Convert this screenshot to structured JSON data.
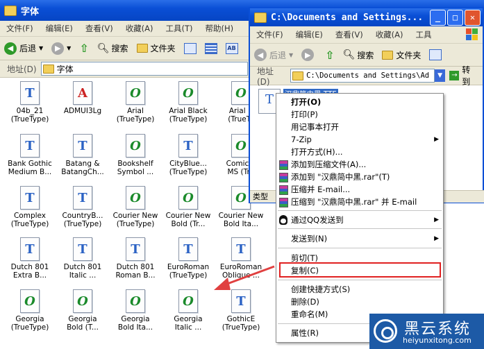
{
  "back_window": {
    "title": "字体",
    "menu": [
      "文件(F)",
      "编辑(E)",
      "查看(V)",
      "收藏(A)",
      "工具(T)",
      "帮助(H)"
    ],
    "toolbar": {
      "back": "后退",
      "search": "搜索",
      "folders": "文件夹"
    },
    "address_label": "地址(D)",
    "address_value": "字体"
  },
  "fonts": [
    {
      "n1": "04b_21",
      "n2": "(TrueType)",
      "kind": "tt"
    },
    {
      "n1": "ADMUI3Lg",
      "n2": "",
      "kind": "ad"
    },
    {
      "n1": "Arial",
      "n2": "(TrueType)",
      "kind": "op"
    },
    {
      "n1": "Arial Black",
      "n2": "(TrueType)",
      "kind": "op"
    },
    {
      "n1": "Arial B",
      "n2": "(TrueTy",
      "kind": "op"
    },
    {
      "n1": "Bank Gothic",
      "n2": "Medium B...",
      "kind": "tt"
    },
    {
      "n1": "Batang &",
      "n2": "BatangCh...",
      "kind": "tt"
    },
    {
      "n1": "Bookshelf",
      "n2": "Symbol ...",
      "kind": "op"
    },
    {
      "n1": "CityBlue...",
      "n2": "(TrueType)",
      "kind": "tt"
    },
    {
      "n1": "Comic S",
      "n2": "MS (Tru",
      "kind": "op"
    },
    {
      "n1": "Complex",
      "n2": "(TrueType)",
      "kind": "tt"
    },
    {
      "n1": "CountryB...",
      "n2": "(TrueType)",
      "kind": "tt"
    },
    {
      "n1": "Courier New",
      "n2": "(TrueType)",
      "kind": "op"
    },
    {
      "n1": "Courier New",
      "n2": "Bold (Tr...",
      "kind": "op"
    },
    {
      "n1": "Courier New",
      "n2": "Bold Ita...",
      "kind": "op"
    },
    {
      "n1": "Dutch 801",
      "n2": "Extra B...",
      "kind": "tt"
    },
    {
      "n1": "Dutch 801",
      "n2": "Italic ...",
      "kind": "tt"
    },
    {
      "n1": "Dutch 801",
      "n2": "Roman B...",
      "kind": "tt"
    },
    {
      "n1": "EuroRoman",
      "n2": "(TrueType)",
      "kind": "tt"
    },
    {
      "n1": "EuroRoman",
      "n2": "Oblique ...",
      "kind": "tt"
    },
    {
      "n1": "Georgia",
      "n2": "(TrueType)",
      "kind": "op"
    },
    {
      "n1": "Georgia",
      "n2": "Bold (T...",
      "kind": "op"
    },
    {
      "n1": "Georgia",
      "n2": "Bold Ita...",
      "kind": "op"
    },
    {
      "n1": "Georgia",
      "n2": "Italic ...",
      "kind": "op"
    },
    {
      "n1": "GothicE",
      "n2": "(TrueType)",
      "kind": "tt"
    }
  ],
  "front_window": {
    "title": "C:\\Documents and Settings...",
    "menu": [
      "文件(F)",
      "编辑(E)",
      "查看(V)",
      "收藏(A)",
      "工具"
    ],
    "toolbar": {
      "back": "后退",
      "search": "搜索",
      "folders": "文件夹"
    },
    "address_label": "地址(D)",
    "address_value": "C:\\Documents and Settings\\Ad",
    "go": "转到",
    "selected_file": "汉鼎简中黑.TTF",
    "status_label": "类型"
  },
  "context_menu": {
    "items": {
      "open": "打开(O)",
      "print": "打印(P)",
      "notepad": "用记事本打开",
      "zip": "7-Zip",
      "openwith": "打开方式(H)...",
      "addarchive": "添加到压缩文件(A)...",
      "addrar": "添加到 \"汉鼎简中黑.rar\"(T)",
      "email": "压缩并 E-mail...",
      "raremail": "压缩到 \"汉鼎简中黑.rar\" 并 E-mail",
      "qq": "通过QQ发送到",
      "sendto": "发送到(N)",
      "cut": "剪切(T)",
      "copy": "复制(C)",
      "shortcut": "创建快捷方式(S)",
      "delete": "删除(D)",
      "rename": "重命名(M)",
      "props": "属性(R)"
    }
  },
  "watermark": {
    "brand": "黑云系统",
    "url": "heiyunxitong.com"
  },
  "colors": {
    "xp_blue": "#0a4fd6",
    "highlight": "#e02020",
    "arrow": "#e04040"
  }
}
